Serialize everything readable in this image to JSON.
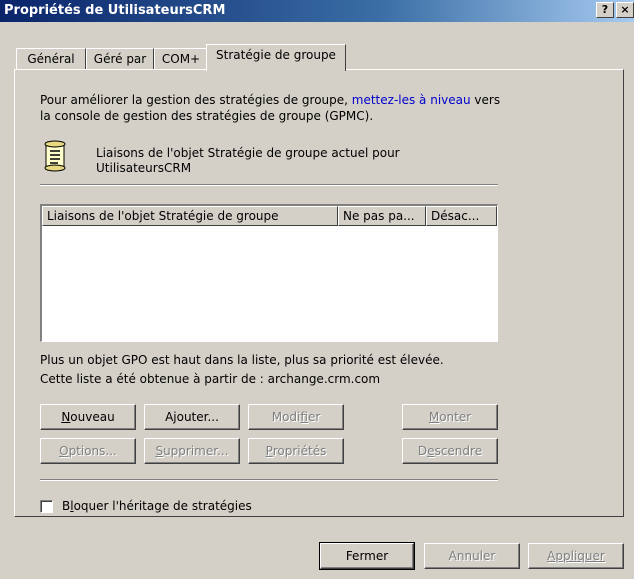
{
  "window": {
    "title": "Propriétés de UtilisateursCRM",
    "help_label": "?",
    "close_label": "×"
  },
  "tabs": [
    {
      "label": "Général",
      "active": false
    },
    {
      "label": "Géré par",
      "active": false
    },
    {
      "label": "COM+",
      "active": false
    },
    {
      "label": "Stratégie de groupe",
      "active": true
    }
  ],
  "info": {
    "line1_prefix": "Pour améliorer la gestion des stratégies de groupe, ",
    "upgrade_link": "mettez-les à niveau",
    "line1_suffix": " vers",
    "line2": "la console de gestion des stratégies de groupe (GPMC)."
  },
  "current_links": {
    "line1": "Liaisons de l'objet Stratégie de groupe actuel pour",
    "line2": "UtilisateursCRM",
    "icon": "scroll-icon"
  },
  "list": {
    "columns": [
      "Liaisons de l'objet Stratégie de groupe",
      "Ne pas pa...",
      "Désac..."
    ],
    "rows": []
  },
  "notes": {
    "priority": "Plus un objet GPO est haut dans la liste, plus sa priorité est élevée.",
    "source": "Cette liste a été obtenue à partir de : archange.crm.com"
  },
  "buttons": {
    "new_first": "N",
    "new_rest": "ouveau",
    "add": "Ajouter...",
    "modify_first": "Modi",
    "modify_u": "f",
    "modify_rest": "ier",
    "up_first": "M",
    "up_rest": "onter",
    "options_first": "O",
    "options_rest": "ptions...",
    "delete_first": "S",
    "delete_rest": "upprimer...",
    "properties_first": "P",
    "properties_rest": "ropriétés",
    "down_first": "D",
    "down_u": "e",
    "down_rest": "scendre"
  },
  "block_inheritance": {
    "label_first": "B",
    "label_u": "l",
    "label_rest": "oquer l'héritage de stratégies",
    "checked": false
  },
  "dialog_buttons": {
    "close": "Fermer",
    "cancel": "Annuler",
    "apply_first": "A",
    "apply_rest": "ppliquer"
  }
}
